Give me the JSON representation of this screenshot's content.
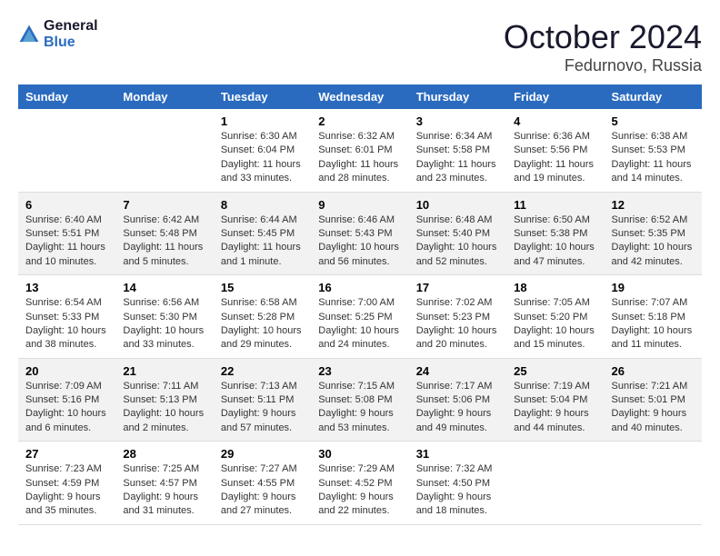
{
  "header": {
    "logo_line1": "General",
    "logo_line2": "Blue",
    "month": "October 2024",
    "location": "Fedurnovo, Russia"
  },
  "weekdays": [
    "Sunday",
    "Monday",
    "Tuesday",
    "Wednesday",
    "Thursday",
    "Friday",
    "Saturday"
  ],
  "weeks": [
    [
      {
        "day": "",
        "info": ""
      },
      {
        "day": "",
        "info": ""
      },
      {
        "day": "1",
        "info": "Sunrise: 6:30 AM\nSunset: 6:04 PM\nDaylight: 11 hours and 33 minutes."
      },
      {
        "day": "2",
        "info": "Sunrise: 6:32 AM\nSunset: 6:01 PM\nDaylight: 11 hours and 28 minutes."
      },
      {
        "day": "3",
        "info": "Sunrise: 6:34 AM\nSunset: 5:58 PM\nDaylight: 11 hours and 23 minutes."
      },
      {
        "day": "4",
        "info": "Sunrise: 6:36 AM\nSunset: 5:56 PM\nDaylight: 11 hours and 19 minutes."
      },
      {
        "day": "5",
        "info": "Sunrise: 6:38 AM\nSunset: 5:53 PM\nDaylight: 11 hours and 14 minutes."
      }
    ],
    [
      {
        "day": "6",
        "info": "Sunrise: 6:40 AM\nSunset: 5:51 PM\nDaylight: 11 hours and 10 minutes."
      },
      {
        "day": "7",
        "info": "Sunrise: 6:42 AM\nSunset: 5:48 PM\nDaylight: 11 hours and 5 minutes."
      },
      {
        "day": "8",
        "info": "Sunrise: 6:44 AM\nSunset: 5:45 PM\nDaylight: 11 hours and 1 minute."
      },
      {
        "day": "9",
        "info": "Sunrise: 6:46 AM\nSunset: 5:43 PM\nDaylight: 10 hours and 56 minutes."
      },
      {
        "day": "10",
        "info": "Sunrise: 6:48 AM\nSunset: 5:40 PM\nDaylight: 10 hours and 52 minutes."
      },
      {
        "day": "11",
        "info": "Sunrise: 6:50 AM\nSunset: 5:38 PM\nDaylight: 10 hours and 47 minutes."
      },
      {
        "day": "12",
        "info": "Sunrise: 6:52 AM\nSunset: 5:35 PM\nDaylight: 10 hours and 42 minutes."
      }
    ],
    [
      {
        "day": "13",
        "info": "Sunrise: 6:54 AM\nSunset: 5:33 PM\nDaylight: 10 hours and 38 minutes."
      },
      {
        "day": "14",
        "info": "Sunrise: 6:56 AM\nSunset: 5:30 PM\nDaylight: 10 hours and 33 minutes."
      },
      {
        "day": "15",
        "info": "Sunrise: 6:58 AM\nSunset: 5:28 PM\nDaylight: 10 hours and 29 minutes."
      },
      {
        "day": "16",
        "info": "Sunrise: 7:00 AM\nSunset: 5:25 PM\nDaylight: 10 hours and 24 minutes."
      },
      {
        "day": "17",
        "info": "Sunrise: 7:02 AM\nSunset: 5:23 PM\nDaylight: 10 hours and 20 minutes."
      },
      {
        "day": "18",
        "info": "Sunrise: 7:05 AM\nSunset: 5:20 PM\nDaylight: 10 hours and 15 minutes."
      },
      {
        "day": "19",
        "info": "Sunrise: 7:07 AM\nSunset: 5:18 PM\nDaylight: 10 hours and 11 minutes."
      }
    ],
    [
      {
        "day": "20",
        "info": "Sunrise: 7:09 AM\nSunset: 5:16 PM\nDaylight: 10 hours and 6 minutes."
      },
      {
        "day": "21",
        "info": "Sunrise: 7:11 AM\nSunset: 5:13 PM\nDaylight: 10 hours and 2 minutes."
      },
      {
        "day": "22",
        "info": "Sunrise: 7:13 AM\nSunset: 5:11 PM\nDaylight: 9 hours and 57 minutes."
      },
      {
        "day": "23",
        "info": "Sunrise: 7:15 AM\nSunset: 5:08 PM\nDaylight: 9 hours and 53 minutes."
      },
      {
        "day": "24",
        "info": "Sunrise: 7:17 AM\nSunset: 5:06 PM\nDaylight: 9 hours and 49 minutes."
      },
      {
        "day": "25",
        "info": "Sunrise: 7:19 AM\nSunset: 5:04 PM\nDaylight: 9 hours and 44 minutes."
      },
      {
        "day": "26",
        "info": "Sunrise: 7:21 AM\nSunset: 5:01 PM\nDaylight: 9 hours and 40 minutes."
      }
    ],
    [
      {
        "day": "27",
        "info": "Sunrise: 7:23 AM\nSunset: 4:59 PM\nDaylight: 9 hours and 35 minutes."
      },
      {
        "day": "28",
        "info": "Sunrise: 7:25 AM\nSunset: 4:57 PM\nDaylight: 9 hours and 31 minutes."
      },
      {
        "day": "29",
        "info": "Sunrise: 7:27 AM\nSunset: 4:55 PM\nDaylight: 9 hours and 27 minutes."
      },
      {
        "day": "30",
        "info": "Sunrise: 7:29 AM\nSunset: 4:52 PM\nDaylight: 9 hours and 22 minutes."
      },
      {
        "day": "31",
        "info": "Sunrise: 7:32 AM\nSunset: 4:50 PM\nDaylight: 9 hours and 18 minutes."
      },
      {
        "day": "",
        "info": ""
      },
      {
        "day": "",
        "info": ""
      }
    ]
  ]
}
